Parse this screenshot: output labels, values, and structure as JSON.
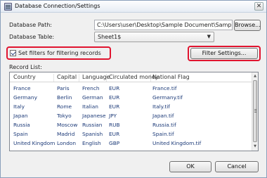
{
  "window": {
    "title": "Database Connection/Settings",
    "close_glyph": "✕"
  },
  "form": {
    "path_label": "Database Path:",
    "path_value": "C:\\Users\\user\\Desktop\\Sample Document\\Sample",
    "browse_label": "Browse...",
    "table_label": "Database Table:",
    "table_value": "Sheet1$",
    "filter_checkbox_label": "Set filters for filtering records",
    "filter_checked": true,
    "filter_settings_label": "Filter Settings...",
    "record_list_label": "Record List:"
  },
  "record_list": {
    "columns": [
      "Country",
      "Capital",
      "Language",
      "Circulated money",
      "National Flag"
    ],
    "rows": [
      [
        "France",
        "Paris",
        "French",
        "EUR",
        "France.tif"
      ],
      [
        "Germany",
        "Berlin",
        "German",
        "EUR",
        "Germany.tif"
      ],
      [
        "Italy",
        "Rome",
        "Italian",
        "EUR",
        "Italy.tif"
      ],
      [
        "Japan",
        "Tokyo",
        "Japanese",
        "JPY",
        "Japan.tif"
      ],
      [
        "Russia",
        "Moscow",
        "Russian",
        "RUB",
        "Russia.tif"
      ],
      [
        "Spain",
        "Madrid",
        "Spanish",
        "EUR",
        "Spain.tif"
      ],
      [
        "United Kingdom",
        "London",
        "English",
        "GBP",
        "United Kingdom.tif"
      ]
    ]
  },
  "footer": {
    "ok_label": "OK",
    "cancel_label": "Cancel"
  },
  "colors": {
    "highlight": "#e0142f",
    "cell_text": "#1c3a78"
  },
  "icons": {
    "window_icon": "database-icon",
    "dropdown": "chevron-down-icon",
    "scroll_up": "scroll-up-icon",
    "scroll_down": "scroll-down-icon"
  }
}
